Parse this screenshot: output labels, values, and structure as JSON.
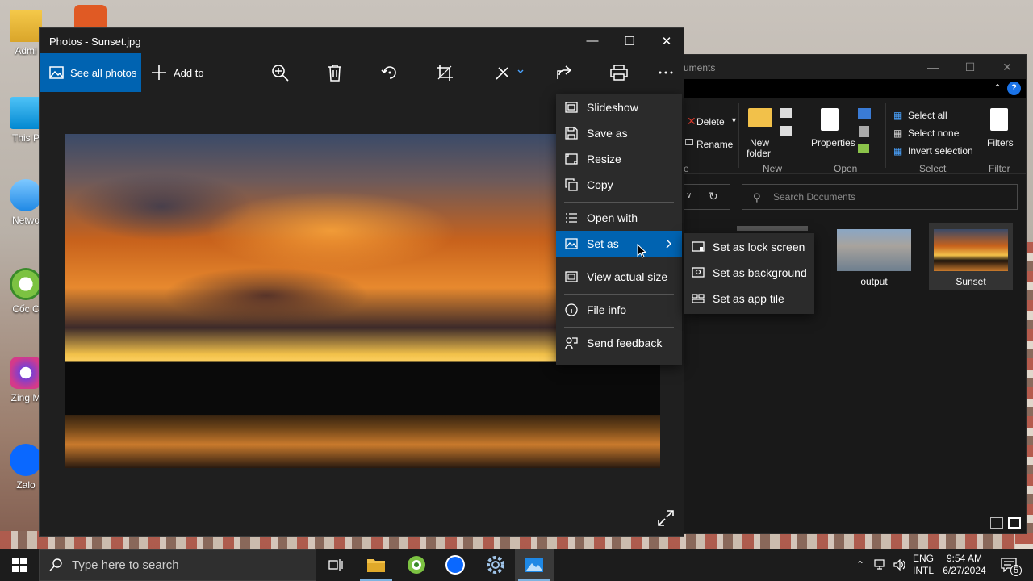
{
  "desktop": {
    "icons": [
      {
        "label": "Admi"
      },
      {
        "label": "This P"
      },
      {
        "label": "Netwo"
      },
      {
        "label": "Cốc C"
      },
      {
        "label": "Zing M"
      },
      {
        "label": "Zalo"
      }
    ]
  },
  "explorer": {
    "title": "uments",
    "ribbon": {
      "delete": "Delete",
      "rename": "Rename",
      "new_folder_1": "New",
      "new_folder_2": "folder",
      "properties": "Properties",
      "select_all": "Select all",
      "select_none": "Select none",
      "invert_selection": "Invert selection",
      "filters": "Filters",
      "groups": {
        "organize": "e",
        "new": "New",
        "open": "Open",
        "select": "Select",
        "filter": "Filter"
      }
    },
    "search_placeholder": "Search Documents",
    "files": [
      {
        "name": "output"
      },
      {
        "name": "Sunset"
      }
    ]
  },
  "photos": {
    "title": "Photos - Sunset.jpg",
    "see_all": "See all photos",
    "add_to": "Add to"
  },
  "menu": {
    "items": [
      {
        "label": "Slideshow",
        "icon": "slideshow-icon"
      },
      {
        "label": "Save as",
        "icon": "save-icon"
      },
      {
        "label": "Resize",
        "icon": "resize-icon"
      },
      {
        "label": "Copy",
        "icon": "copy-icon"
      },
      {
        "label": "Open with",
        "icon": "open-with-icon"
      },
      {
        "label": "Set as",
        "icon": "picture-icon"
      },
      {
        "label": "View actual size",
        "icon": "actual-size-icon"
      },
      {
        "label": "File info",
        "icon": "info-icon"
      },
      {
        "label": "Send feedback",
        "icon": "feedback-icon"
      }
    ],
    "submenu": [
      {
        "label": "Set as lock screen"
      },
      {
        "label": "Set as background"
      },
      {
        "label": "Set as app tile"
      }
    ]
  },
  "taskbar": {
    "search_placeholder": "Type here to search",
    "lang_1": "ENG",
    "lang_2": "INTL",
    "time": "9:54 AM",
    "date": "6/27/2024",
    "notifications": "5"
  },
  "colors": {
    "accent": "#0063b1",
    "window_bg": "#1f1f1f",
    "menu_bg": "#2b2b2b"
  }
}
